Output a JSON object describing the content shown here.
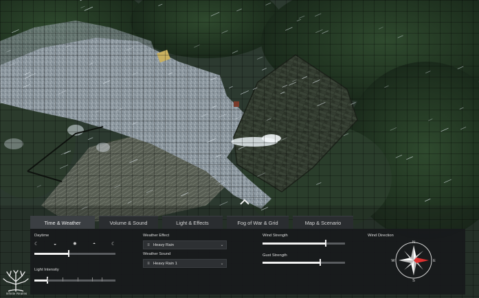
{
  "tabs": [
    {
      "label": "Time & Weather",
      "active": true
    },
    {
      "label": "Volume & Sound",
      "active": false
    },
    {
      "label": "Light & Effects",
      "active": false
    },
    {
      "label": "Fog of War & Grid",
      "active": false
    },
    {
      "label": "Map & Scenario",
      "active": false
    }
  ],
  "daytime": {
    "label": "Daytime",
    "icons": [
      "moon-icon",
      "sunrise-icon",
      "sun-icon",
      "sunset-icon",
      "moon-icon"
    ],
    "icon_glyphs": [
      "☾",
      "◒",
      "✹",
      "◓",
      "☾"
    ],
    "value": 0.42
  },
  "light_intensity": {
    "label": "Light Intensity",
    "value": 0.16
  },
  "weather_effect": {
    "label": "Weather Effect",
    "selected": "Heavy Rain",
    "glyph": "≡",
    "chevron": "⌄"
  },
  "weather_sound": {
    "label": "Weather Sound",
    "selected": "Heavy Rain 1",
    "glyph": "≡",
    "chevron": "⌄"
  },
  "wind_strength": {
    "label": "Wind Strength",
    "value": 0.77
  },
  "gust_strength": {
    "label": "Gust Strength",
    "value": 0.7
  },
  "wind_direction": {
    "label": "Wind Direction",
    "N": "N",
    "S": "S",
    "E": "E",
    "W": "W",
    "heading_degrees": 90
  },
  "collapse_icon": "chevron-up-icon",
  "logo": {
    "name": "Infinite Realms",
    "icon": "tree-icon"
  },
  "colors": {
    "panel": "#181a1c",
    "tab": "#2a2d30",
    "tab_active": "#3b3f43",
    "slider_fill": "#f2f2f2",
    "compass_accent": "#e03030"
  }
}
